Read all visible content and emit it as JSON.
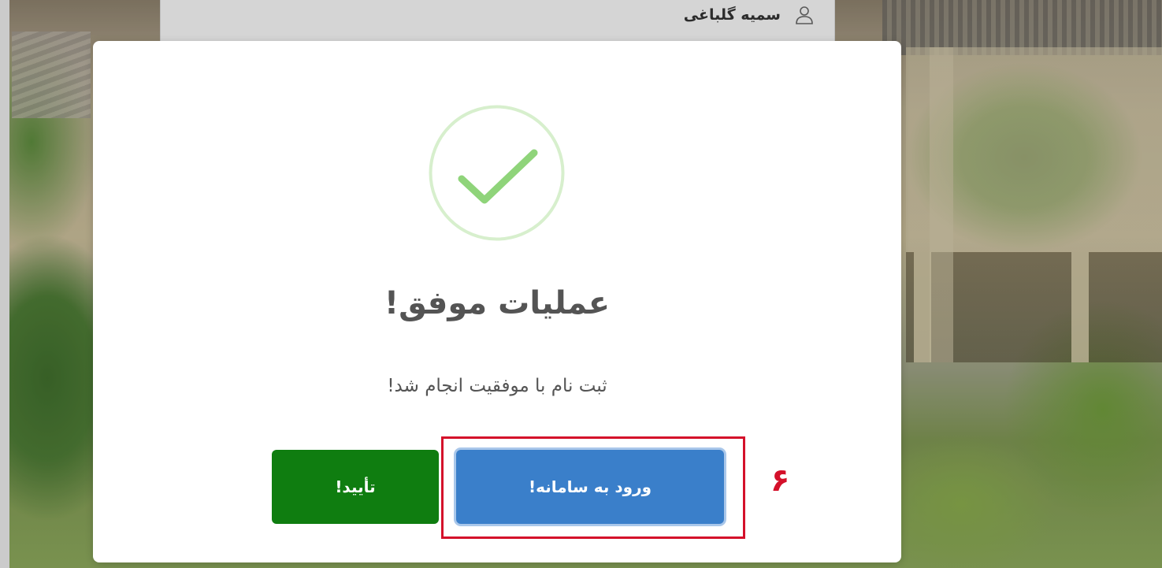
{
  "background": {
    "under_card": {
      "user_name": "سمیه گلباغی",
      "user_icon": "user-icon"
    }
  },
  "modal": {
    "status_icon": "checkmark-circle-icon",
    "title": "عملیات موفق!",
    "message": "ثبت نام با موفقیت انجام شد!",
    "buttons": {
      "confirm_label": "تأیید!",
      "login_label": "ورود به سامانه!"
    },
    "annotation": {
      "step_number": "۶"
    }
  },
  "colors": {
    "success_green": "#8fd47a",
    "confirm_button": "#0f7d10",
    "login_button": "#3a7fca",
    "annotation_red": "#d4102a",
    "text_gray": "#545454"
  }
}
